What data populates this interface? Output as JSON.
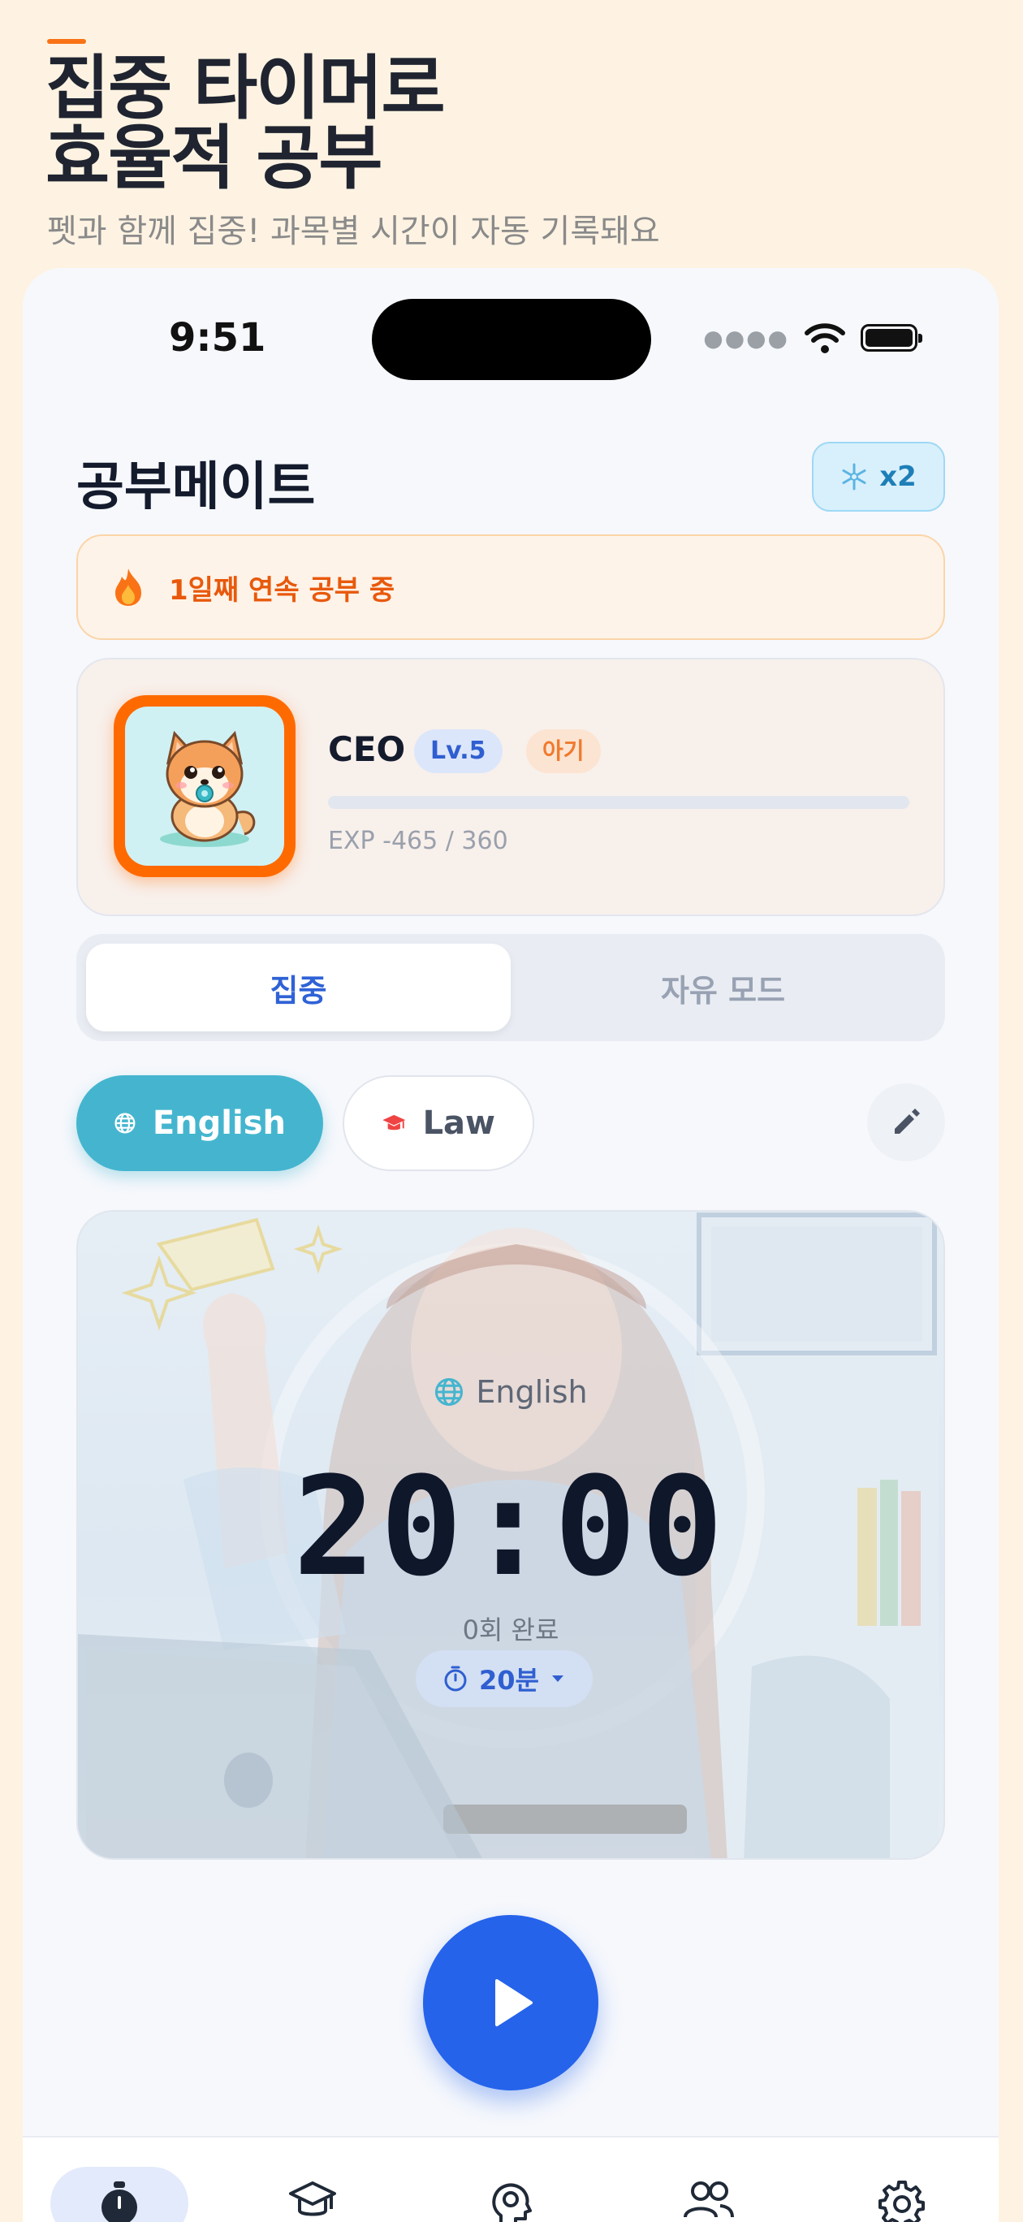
{
  "hero": {
    "title_line1": "집중 타이머로",
    "title_line2": "효율적 공부",
    "subtitle": "펫과 함께 집중! 과목별 시간이 자동 기록돼요"
  },
  "status_bar": {
    "time": "9:51",
    "icons": [
      "signal-dots-icon",
      "wifi-icon",
      "battery-icon"
    ]
  },
  "header": {
    "title": "공부메이트",
    "freeze_count": "x2",
    "freeze_icon": "snowflake-icon"
  },
  "streak": {
    "icon": "flame-icon",
    "text": "1일째 연속 공부 중"
  },
  "pet": {
    "name": "CEO",
    "level": "Lv.5",
    "stage": "아기",
    "exp_text": "EXP -465 / 360",
    "exp_progress": 0
  },
  "mode_tabs": [
    {
      "label": "집중",
      "active": true
    },
    {
      "label": "자유 모드",
      "active": false
    }
  ],
  "subjects": [
    {
      "label": "English",
      "icon": "globe-icon",
      "selected": true
    },
    {
      "label": "Law",
      "icon": "graduation-cap-icon",
      "selected": false
    }
  ],
  "timer": {
    "subject": "English",
    "display": "20:00",
    "sessions": "0회 완료",
    "duration": "20분"
  },
  "tabbar": [
    {
      "name": "timer",
      "icon": "stopwatch-icon",
      "active": true
    },
    {
      "name": "study",
      "icon": "graduation-cap-icon",
      "active": false
    },
    {
      "name": "mind",
      "icon": "head-gear-icon",
      "active": false
    },
    {
      "name": "friends",
      "icon": "users-icon",
      "active": false
    },
    {
      "name": "settings",
      "icon": "gear-icon",
      "active": false
    }
  ],
  "colors": {
    "page_bg": "#FEF3E2",
    "accent_orange": "#F97316",
    "primary_blue": "#2563EB",
    "subject_teal": "#45B5CF"
  }
}
